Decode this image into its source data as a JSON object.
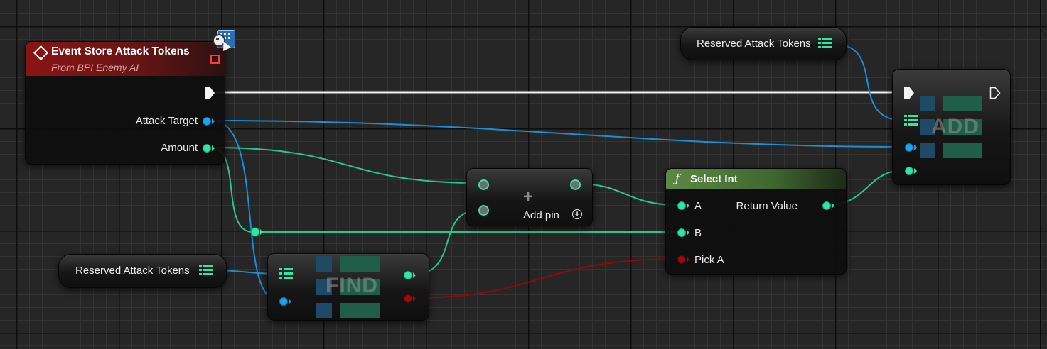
{
  "window": {
    "width": 1473,
    "height": 492
  },
  "colors": {
    "exec": "#f4f4f4",
    "integer": "#2ee6a6",
    "object": "#1ba2f0",
    "boolean": "#a00909",
    "event_header": "#8a1414",
    "function_header": "#5b8a43"
  },
  "event_node": {
    "title": "Event Store Attack Tokens",
    "subtitle": "From BPI Enemy AI",
    "title_icon": "event-diamond-icon",
    "delegate_icon": "delegate-square-icon",
    "interface_badge_icon": "interface-badge-icon",
    "pins": {
      "attack_target": "Attack Target",
      "amount": "Amount"
    }
  },
  "var_top": {
    "label": "Reserved Attack Tokens",
    "icon": "array-icon"
  },
  "var_bottom": {
    "label": "Reserved Attack Tokens",
    "icon": "array-icon"
  },
  "add_node": {
    "title": "ADD"
  },
  "find_node": {
    "title": "FIND"
  },
  "plus_node": {
    "add_pin_label": "Add pin",
    "plus_glyph": "+",
    "add_pin_glyph": "+"
  },
  "select_node": {
    "title": "Select Int",
    "title_icon_glyph": "ƒ",
    "pins": {
      "a": "A",
      "b": "B",
      "pick_a": "Pick A",
      "return_value": "Return Value"
    }
  }
}
